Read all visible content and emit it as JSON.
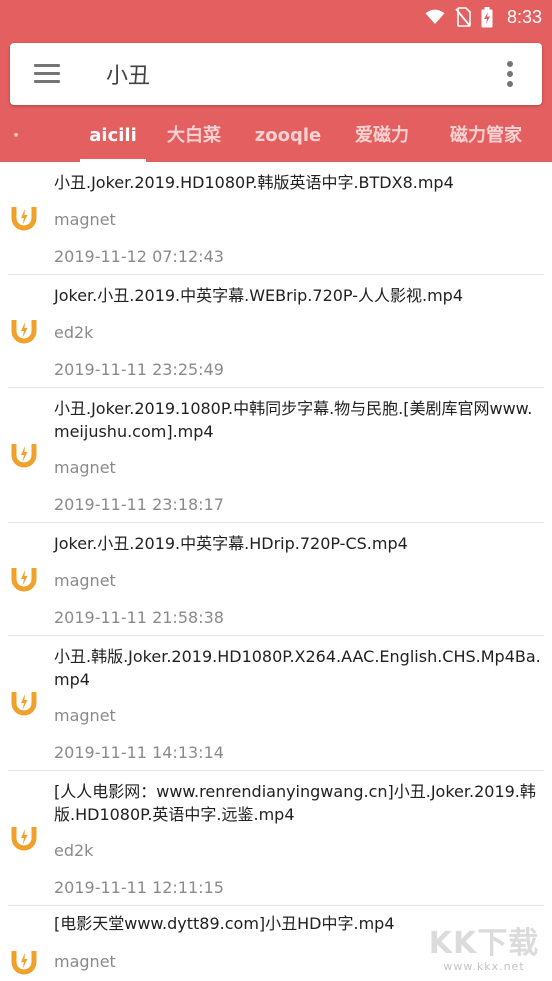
{
  "status_bar": {
    "time": "8:33",
    "icons": [
      "wifi-icon",
      "no-sim-icon",
      "battery-charging-icon"
    ]
  },
  "search": {
    "query": "小丑",
    "icons": [
      "menu-icon",
      "more-vert-icon"
    ]
  },
  "tabs": {
    "items": [
      {
        "label": "·",
        "active": false
      },
      {
        "label": "aicili",
        "active": true
      },
      {
        "label": "大白菜",
        "active": false
      },
      {
        "label": "zooqle",
        "active": false
      },
      {
        "label": "爱磁力",
        "active": false
      },
      {
        "label": "磁力管家",
        "active": false
      }
    ]
  },
  "results": [
    {
      "title": "小丑.Joker.2019.HD1080P.韩版英语中字.BTDX8.mp4",
      "type": "magnet",
      "date": "2019-11-12 07:12:43",
      "icon": "magnet-icon"
    },
    {
      "title": "Joker.小丑.2019.中英字幕.WEBrip.720P-人人影视.mp4",
      "type": "ed2k",
      "date": "2019-11-11 23:25:49",
      "icon": "magnet-icon"
    },
    {
      "title": "小丑.Joker.2019.1080P.中韩同步字幕.物与民胞.[美剧库官网www.meijushu.com].mp4",
      "type": "magnet",
      "date": "2019-11-11 23:18:17",
      "icon": "magnet-icon"
    },
    {
      "title": "Joker.小丑.2019.中英字幕.HDrip.720P-CS.mp4",
      "type": "magnet",
      "date": "2019-11-11 21:58:38",
      "icon": "magnet-icon"
    },
    {
      "title": "小丑.韩版.Joker.2019.HD1080P.X264.AAC.English.CHS.Mp4Ba.mp4",
      "type": "magnet",
      "date": "2019-11-11 14:13:14",
      "icon": "magnet-icon"
    },
    {
      "title": "[人人电影网：www.renrendianyingwang.cn]小丑.Joker.2019.韩版.HD1080P.英语中字.远鉴.mp4",
      "type": "ed2k",
      "date": "2019-11-11 12:11:15",
      "icon": "magnet-icon"
    },
    {
      "title": "[电影天堂www.dytt89.com]小丑HD中字.mp4",
      "type": "magnet",
      "date": "",
      "icon": "magnet-icon"
    }
  ],
  "watermark": {
    "logo": "KK下载",
    "url": "www.kkx.net"
  },
  "colors": {
    "primary": "#e45f5f",
    "magnet_icon": "#f0a12b",
    "secondary_text": "#8a8a8a"
  }
}
